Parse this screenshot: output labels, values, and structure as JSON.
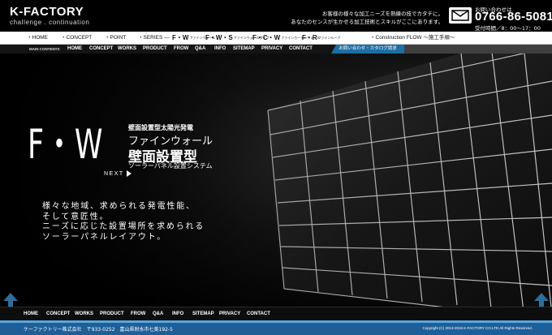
{
  "header": {
    "logo_main": "K-FACTORY",
    "logo_sub": "challenge . continuation",
    "tagline_line1": "お客様の様々な加工ニーズを熟練の技でカタチに。",
    "tagline_line2": "あなたのセンスが生かせる加工技術とスキルがここにあります。",
    "contact_label": "お問い合わせは",
    "phone": "0766-86-5081",
    "hours": "受付時間／8：00〜17：00"
  },
  "nav1": {
    "home": "・HOME",
    "concept": "・CONCEPT",
    "point": "・POINT",
    "series": "・SERIES ―",
    "fw": "F・W",
    "fw_sub": "ファインウォール",
    "fws": "F・W・S",
    "fws_sub": "ファインウォールタイプ",
    "fcw": "F・C・W",
    "fcw_sub": "ファインカーテンウォール",
    "fr": "F・R",
    "fr_sub": "ファインルーフ",
    "flow": "・Construction FLOW 〜施工手順〜"
  },
  "nav2": {
    "label": "MAIN CONTENTS",
    "items": [
      "HOME",
      "CONCEPT",
      "WORKS",
      "PRODUCT",
      "FROW",
      "Q&A",
      "INFO",
      "SITEMAP",
      "PRIVACY",
      "CONTACT"
    ],
    "inquiry": "お問い合わせ・カタログ請求"
  },
  "hero": {
    "fw_title": "F・W",
    "subtitle1": "壁面設置型太陽光発電",
    "subtitle2": "ファインウォール",
    "subtitle3": "壁面設置型",
    "subtitle4": "ソーラーパネル設置システム",
    "next": "NEXT",
    "desc": [
      "様々な地域、求められる発電性能、",
      "そして意匠性。",
      "ニーズに応じた設置場所を求められる",
      "ソーラーパネルレイアウト。"
    ]
  },
  "footer": {
    "nav": [
      "HOME",
      "CONCEPT",
      "WORKS",
      "PRODUCT",
      "FROW",
      "Q&A",
      "INFO",
      "SITEMAP",
      "PRIVACY",
      "CONTACT"
    ],
    "company": "ケーファクトリー株式会社　〒933-0252　富山県射水市七美192-5",
    "copyright": "Copyright (C) 2013-2015 K-FACTORY CO.LTD All Rights Reserved."
  },
  "colors": {
    "accent_blue": "#1e5f99",
    "inquiry_blue": "#1c6ea4",
    "up_arrow": "#2f6d9a"
  },
  "icons": [
    "mail-icon",
    "up-arrow-icon",
    "next-arrow-icon"
  ]
}
